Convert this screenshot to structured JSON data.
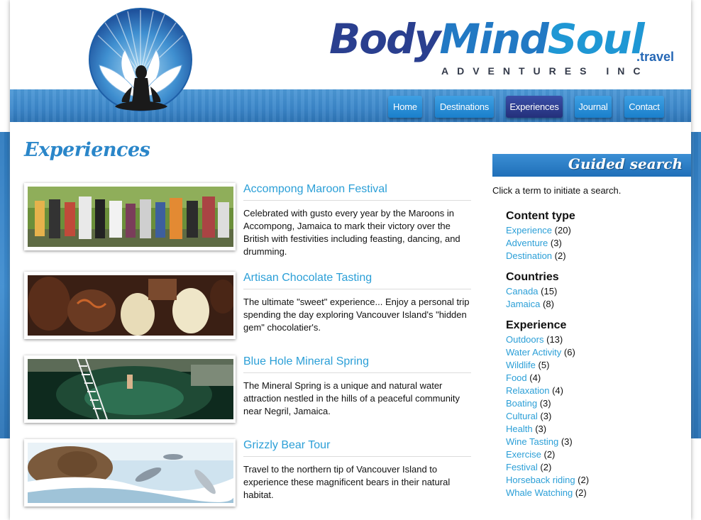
{
  "brand": {
    "word1": "Body",
    "word2": "Mind",
    "word3": "Soul",
    "tld": ".travel",
    "subtitle": "ADVENTURES INC"
  },
  "nav": {
    "items": [
      {
        "label": "Home",
        "active": false
      },
      {
        "label": "Destinations",
        "active": false
      },
      {
        "label": "Experiences",
        "active": true
      },
      {
        "label": "Journal",
        "active": false
      },
      {
        "label": "Contact",
        "active": false
      }
    ]
  },
  "main": {
    "title": "Experiences",
    "items": [
      {
        "title": "Accompong Maroon Festival",
        "description": "Celebrated with gusto every year by the Maroons in Accompong, Jamaica to mark their victory over the British with festivities including feasting, dancing, and drumming."
      },
      {
        "title": "Artisan Chocolate Tasting",
        "description": "The ultimate \"sweet\" experience... Enjoy a personal trip spending the day exploring Vancouver Island's \"hidden gem\" chocolatier's."
      },
      {
        "title": "Blue Hole Mineral Spring",
        "description": "The Mineral Spring is a unique and natural water attraction nestled in the hills of a peaceful community near Negril, Jamaica."
      },
      {
        "title": "Grizzly Bear Tour",
        "description": "Travel to the northern tip of Vancouver Island to experience these magnificent bears in their natural habitat."
      }
    ]
  },
  "sidebar": {
    "heading": "Guided search",
    "intro": "Click a term to initiate a search.",
    "facets": [
      {
        "title": "Content type",
        "terms": [
          {
            "label": "Experience",
            "count": "(20)"
          },
          {
            "label": "Adventure",
            "count": "(3)"
          },
          {
            "label": "Destination",
            "count": "(2)"
          }
        ]
      },
      {
        "title": "Countries",
        "terms": [
          {
            "label": "Canada",
            "count": "(15)"
          },
          {
            "label": "Jamaica",
            "count": "(8)"
          }
        ]
      },
      {
        "title": "Experience",
        "terms": [
          {
            "label": "Outdoors",
            "count": "(13)"
          },
          {
            "label": "Water Activity",
            "count": "(6)"
          },
          {
            "label": "Wildlife",
            "count": "(5)"
          },
          {
            "label": "Food",
            "count": "(4)"
          },
          {
            "label": "Relaxation",
            "count": "(4)"
          },
          {
            "label": "Boating",
            "count": "(3)"
          },
          {
            "label": "Cultural",
            "count": "(3)"
          },
          {
            "label": "Health",
            "count": "(3)"
          },
          {
            "label": "Wine Tasting",
            "count": "(3)"
          },
          {
            "label": "Exercise",
            "count": "(2)"
          },
          {
            "label": "Festival",
            "count": "(2)"
          },
          {
            "label": "Horseback riding",
            "count": "(2)"
          },
          {
            "label": "Whale Watching",
            "count": "(2)"
          }
        ]
      }
    ]
  },
  "colors": {
    "accent_blue": "#2b9fd7",
    "nav_active": "#2a3a8f",
    "band_blue": "#3a86c9"
  },
  "icons": {
    "logo": "lotus-meditation-logo"
  }
}
